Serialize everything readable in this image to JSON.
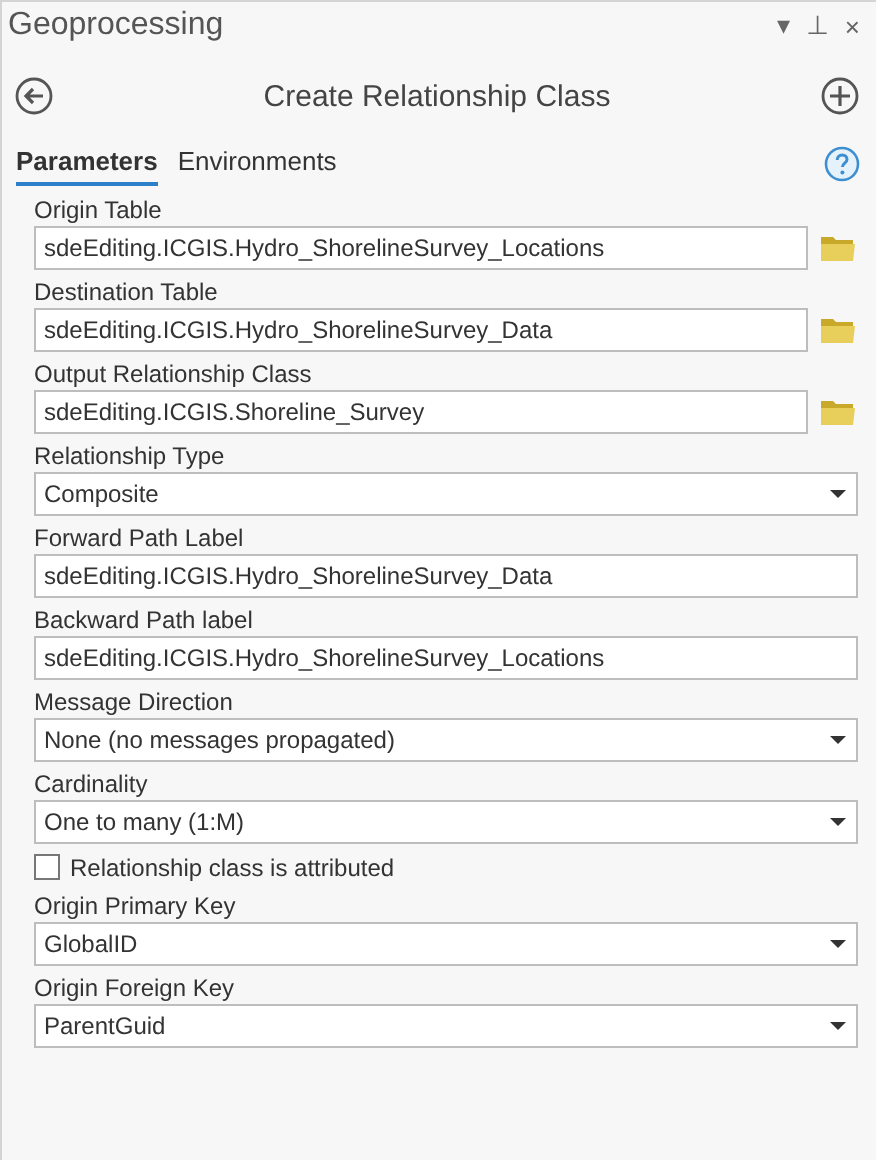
{
  "window": {
    "title": "Geoprocessing",
    "controls": [
      "▾",
      "⊥",
      "×"
    ]
  },
  "header": {
    "title": "Create Relationship Class"
  },
  "tabs": [
    {
      "label": "Parameters",
      "selected": true
    },
    {
      "label": "Environments",
      "selected": false
    }
  ],
  "fields": [
    {
      "kind": "path",
      "label": "Origin Table",
      "value": "sdeEditing.ICGIS.Hydro_ShorelineSurvey_Locations"
    },
    {
      "kind": "path",
      "label": "Destination Table",
      "value": "sdeEditing.ICGIS.Hydro_ShorelineSurvey_Data"
    },
    {
      "kind": "path",
      "label": "Output Relationship Class",
      "value": "sdeEditing.ICGIS.Shoreline_Survey"
    },
    {
      "kind": "dropdown",
      "label": "Relationship Type",
      "value": "Composite"
    },
    {
      "kind": "text",
      "label": "Forward Path Label",
      "value": "sdeEditing.ICGIS.Hydro_ShorelineSurvey_Data"
    },
    {
      "kind": "text",
      "label": "Backward Path label",
      "value": "sdeEditing.ICGIS.Hydro_ShorelineSurvey_Locations"
    },
    {
      "kind": "dropdown",
      "label": "Message Direction",
      "value": "None (no messages propagated)"
    },
    {
      "kind": "dropdown",
      "label": "Cardinality",
      "value": "One to many (1:M)"
    },
    {
      "kind": "checkbox",
      "label": "Relationship class is attributed",
      "checked": false
    },
    {
      "kind": "dropdown",
      "label": "Origin Primary Key",
      "value": "GlobalID"
    },
    {
      "kind": "dropdown",
      "label": "Origin Foreign Key",
      "value": "ParentGuid"
    }
  ]
}
